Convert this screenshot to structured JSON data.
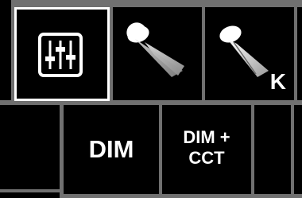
{
  "modes": {
    "settings": {
      "icon": "faders-icon",
      "selected": true
    },
    "spot": {
      "icon": "spotlight-icon"
    },
    "spot_cct": {
      "icon": "spotlight-kelvin-icon",
      "badge": "K"
    },
    "dim": {
      "label": "DIM"
    },
    "dim_cct": {
      "line1": "DIM +",
      "line2": "CCT"
    }
  },
  "colors": {
    "background": "#707070",
    "tile": "#000000",
    "selected_border": "#ffffff",
    "icon": "#ffffff"
  }
}
